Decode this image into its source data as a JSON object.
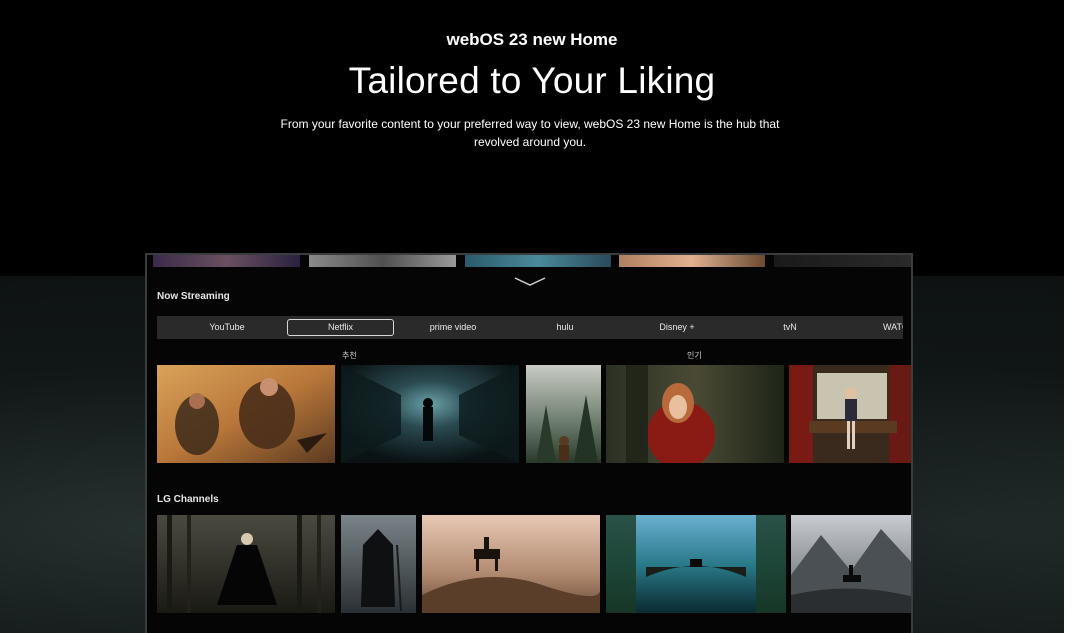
{
  "hero": {
    "eyebrow": "webOS 23 new Home",
    "headline": "Tailored to Your Liking",
    "description": "From your favorite content to your preferred way to view, webOS 23 new Home is the hub that revolved around you."
  },
  "tv": {
    "now_streaming": {
      "title": "Now Streaming",
      "tabs": [
        "YouTube",
        "Netflix",
        "prime video",
        "hulu",
        "Disney +",
        "tvN",
        "WATCHA"
      ],
      "selected_tab": "Netflix",
      "category_labels": [
        "추천",
        "인기"
      ],
      "cards": [
        "desert-fighters-card",
        "dark-tunnel-card",
        "forest-wanderer-card",
        "red-hood-girl-card",
        "girl-by-window-card"
      ]
    },
    "lg_channels": {
      "title": "LG Channels",
      "cards": [
        "dark-forest-dancer-card",
        "hooded-figure-card",
        "horse-rider-hill-card",
        "stone-bridge-card",
        "mountain-rider-card"
      ]
    }
  },
  "colors": {
    "background": "#000000",
    "tab_bar": "#2a2a2a",
    "tv_frame": "#3a3d3e"
  }
}
